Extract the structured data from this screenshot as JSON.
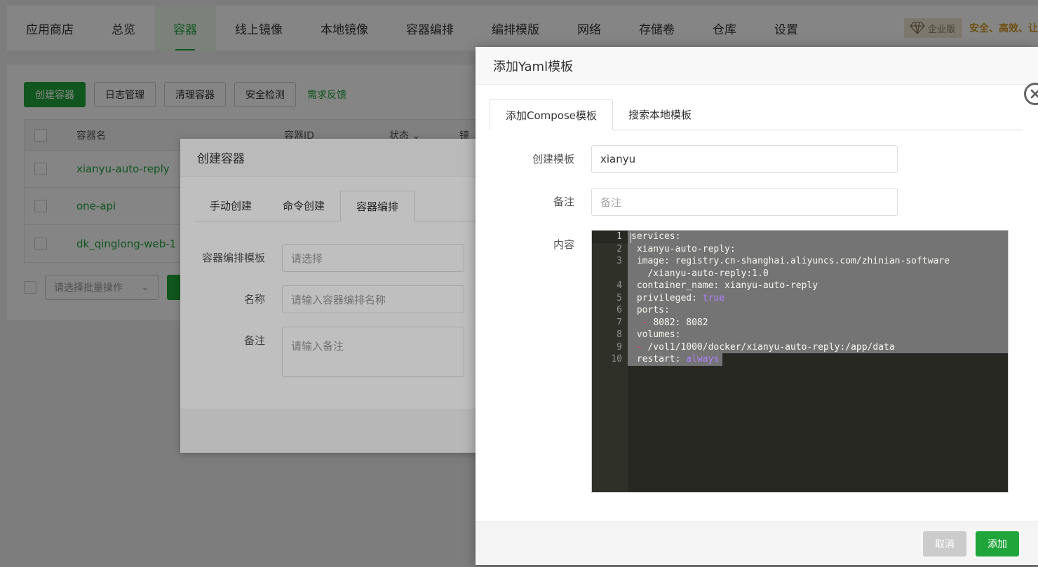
{
  "nav": {
    "items": [
      {
        "label": "应用商店"
      },
      {
        "label": "总览"
      },
      {
        "label": "容器"
      },
      {
        "label": "线上镜像"
      },
      {
        "label": "本地镜像"
      },
      {
        "label": "容器编排"
      },
      {
        "label": "编排模版"
      },
      {
        "label": "网络"
      },
      {
        "label": "存储卷"
      },
      {
        "label": "仓库"
      },
      {
        "label": "设置"
      }
    ],
    "active_index": 2,
    "enterprise_label": "企业版",
    "enterprise_slogan": "安全、高效、让"
  },
  "toolbar": {
    "create": "创建容器",
    "logs": "日志管理",
    "cleanup": "清理容器",
    "security": "安全检测",
    "feedback": "需求反馈"
  },
  "table": {
    "headers": {
      "name": "容器名",
      "id": "容器ID",
      "status": "状态",
      "image": "镜"
    },
    "rows": [
      {
        "name": "xianyu-auto-reply"
      },
      {
        "name": "one-api"
      },
      {
        "name": "dk_qinglong-web-1"
      }
    ]
  },
  "batch": {
    "placeholder": "请选择批量操作"
  },
  "create_dialog": {
    "title": "创建容器",
    "tabs": [
      "手动创建",
      "命令创建",
      "容器编排"
    ],
    "active_tab": 2,
    "fields": {
      "template_label": "容器编排模板",
      "template_placeholder": "请选择",
      "name_label": "名称",
      "name_placeholder": "请输入容器编排名称",
      "remark_label": "备注",
      "remark_placeholder": "请输入备注"
    }
  },
  "yaml_dialog": {
    "title": "添加Yaml模板",
    "tabs": [
      "添加Compose模板",
      "搜索本地模板"
    ],
    "active_tab": 0,
    "fields": {
      "template_label": "创建模板",
      "template_value": "xianyu",
      "remark_label": "备注",
      "remark_placeholder": "备注",
      "content_label": "内容"
    },
    "editor": {
      "line_numbers": [
        "1",
        "2",
        "3",
        "",
        "4",
        "5",
        "6",
        "7",
        "8",
        "9",
        "10"
      ],
      "code": {
        "l1": "services:",
        "l2": " xianyu-auto-reply:",
        "l3": " image: registry.cn-shanghai.aliyuncs.com/zhinian-software",
        "l3b": "   /xianyu-auto-reply:1.0",
        "l4": " container_name: xianyu-auto-reply",
        "l5k": " privileged: ",
        "l5v": "true",
        "l6": " ports:",
        "l7d": "  - ",
        "l7v": "8082: 8082",
        "l8": " volumes:",
        "l9d": " - ",
        "l9v": "/vol1/1000/docker/xianyu-auto-reply:/app/data",
        "l10k": " restart: ",
        "l10v": "always"
      }
    },
    "buttons": {
      "cancel": "取消",
      "add": "添加"
    }
  },
  "colors": {
    "accent": "#20a53a",
    "editor_bg": "#272822",
    "boolean": "#ae81ff"
  }
}
